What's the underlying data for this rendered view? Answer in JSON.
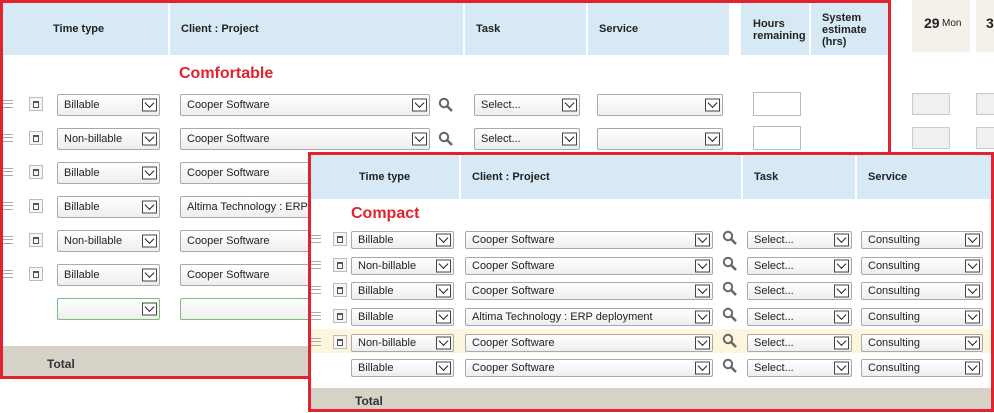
{
  "comfortable": {
    "label": "Comfortable",
    "headers": {
      "time_type": "Time type",
      "client_project": "Client : Project",
      "task": "Task",
      "service": "Service",
      "hours_remaining_1": "Hours",
      "hours_remaining_2": "remaining",
      "system_estimate_1": "System",
      "system_estimate_2": "estimate",
      "system_estimate_3": "(hrs)"
    },
    "day": {
      "number": "29",
      "name": "Mon",
      "next_number": "3"
    },
    "rows": [
      {
        "time_type": "Billable",
        "client_project": "Cooper Software",
        "task": "Select...",
        "service": ""
      },
      {
        "time_type": "Non-billable",
        "client_project": "Cooper Software",
        "task": "Select...",
        "service": ""
      },
      {
        "time_type": "Billable",
        "client_project": "Cooper Software"
      },
      {
        "time_type": "Billable",
        "client_project": "Altima Technology : ERP d"
      },
      {
        "time_type": "Non-billable",
        "client_project": "Cooper Software"
      },
      {
        "time_type": "Billable",
        "client_project": "Cooper Software"
      },
      {
        "time_type": "",
        "client_project": ""
      }
    ],
    "total_label": "Total"
  },
  "compact": {
    "label": "Compact",
    "headers": {
      "time_type": "Time type",
      "client_project": "Client : Project",
      "task": "Task",
      "service": "Service"
    },
    "rows": [
      {
        "time_type": "Billable",
        "client_project": "Cooper Software",
        "task": "Select...",
        "service": "Consulting"
      },
      {
        "time_type": "Non-billable",
        "client_project": "Cooper Software",
        "task": "Select...",
        "service": "Consulting"
      },
      {
        "time_type": "Billable",
        "client_project": "Cooper Software",
        "task": "Select...",
        "service": "Consulting"
      },
      {
        "time_type": "Billable",
        "client_project": "Altima Technology : ERP deployment",
        "task": "Select...",
        "service": "Consulting"
      },
      {
        "time_type": "Non-billable",
        "client_project": "Cooper Software",
        "task": "Select...",
        "service": "Consulting"
      },
      {
        "time_type": "Billable",
        "client_project": "Cooper Software",
        "task": "Select...",
        "service": "Consulting"
      }
    ],
    "total_label": "Total"
  },
  "icons": {
    "drag": "drag-handle-icon",
    "trash": "trash-icon",
    "lens": "magnifier-icon",
    "chevron": "chevron-down-icon"
  },
  "colors": {
    "accent_red": "#e0232e",
    "header_bg": "#d6e9f5",
    "total_bg": "#d6d2c8",
    "highlight_row": "#fbf6dc"
  }
}
